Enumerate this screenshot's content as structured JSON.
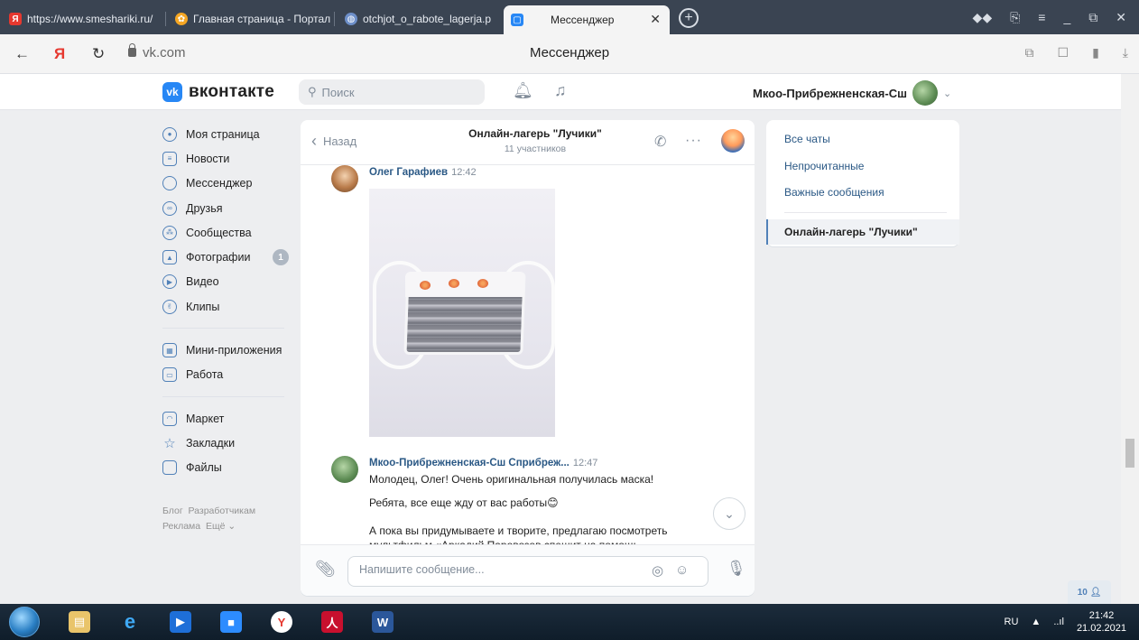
{
  "browser": {
    "tabs": [
      {
        "label": "https://www.smeshariki.ru/"
      },
      {
        "label": "Главная страница - Портал"
      },
      {
        "label": "otchjot_o_rabote_lagerja.p"
      },
      {
        "label": "Мессенджер"
      }
    ],
    "address": "vk.com",
    "page_title": "Мессенджер",
    "colors": {
      "tabbar": "#3a4452",
      "active_tab": "#f4f4f4"
    }
  },
  "vk_header": {
    "logo_text": "вконтакте",
    "search_placeholder": "Поиск",
    "user_name": "Мкоо-Прибрежненская-Сш",
    "accent": "#5181b8"
  },
  "left_nav": {
    "items": [
      {
        "label": "Моя страница",
        "icon": "user-circle-icon"
      },
      {
        "label": "Новости",
        "icon": "news-icon"
      },
      {
        "label": "Мессенджер",
        "icon": "message-icon"
      },
      {
        "label": "Друзья",
        "icon": "friends-icon"
      },
      {
        "label": "Сообщества",
        "icon": "communities-icon"
      },
      {
        "label": "Фотографии",
        "icon": "photos-icon",
        "badge": "1"
      },
      {
        "label": "Видео",
        "icon": "video-icon"
      },
      {
        "label": "Клипы",
        "icon": "clips-icon"
      }
    ],
    "items2": [
      {
        "label": "Мини-приложения",
        "icon": "apps-icon"
      },
      {
        "label": "Работа",
        "icon": "work-icon"
      }
    ],
    "items3": [
      {
        "label": "Маркет",
        "icon": "market-icon"
      },
      {
        "label": "Закладки",
        "icon": "bookmarks-icon"
      },
      {
        "label": "Файлы",
        "icon": "files-icon"
      }
    ],
    "footer": {
      "blog": "Блог",
      "dev": "Разработчикам",
      "ads": "Реклама",
      "more": "Ещё"
    }
  },
  "chat": {
    "back_label": "Назад",
    "title": "Онлайн-лагерь \"Лучики\"",
    "subtitle": "11 участников",
    "messages": [
      {
        "author": "Олег Гарафиев",
        "time": "12:42"
      },
      {
        "author": "Мкоо-Прибрежненская-Сш Сприбреж...",
        "time": "12:47",
        "lines": [
          "Молодец, Олег! Очень оригинальная получилась маска!",
          "Ребята, все еще жду от вас работы😊",
          "А пока вы придумываете и творите, предлагаю посмотреть",
          "мультфильм «Аркадий Паровозов спешит на помощь"
        ]
      }
    ],
    "composer_placeholder": "Напишите сообщение..."
  },
  "right_panel": {
    "links": [
      "Все чаты",
      "Непрочитанные",
      "Важные сообщения"
    ],
    "active": "Онлайн-лагерь \"Лучики\""
  },
  "people_badge": "10",
  "taskbar": {
    "lang": "RU",
    "time": "21:42",
    "date": "21.02.2021"
  }
}
